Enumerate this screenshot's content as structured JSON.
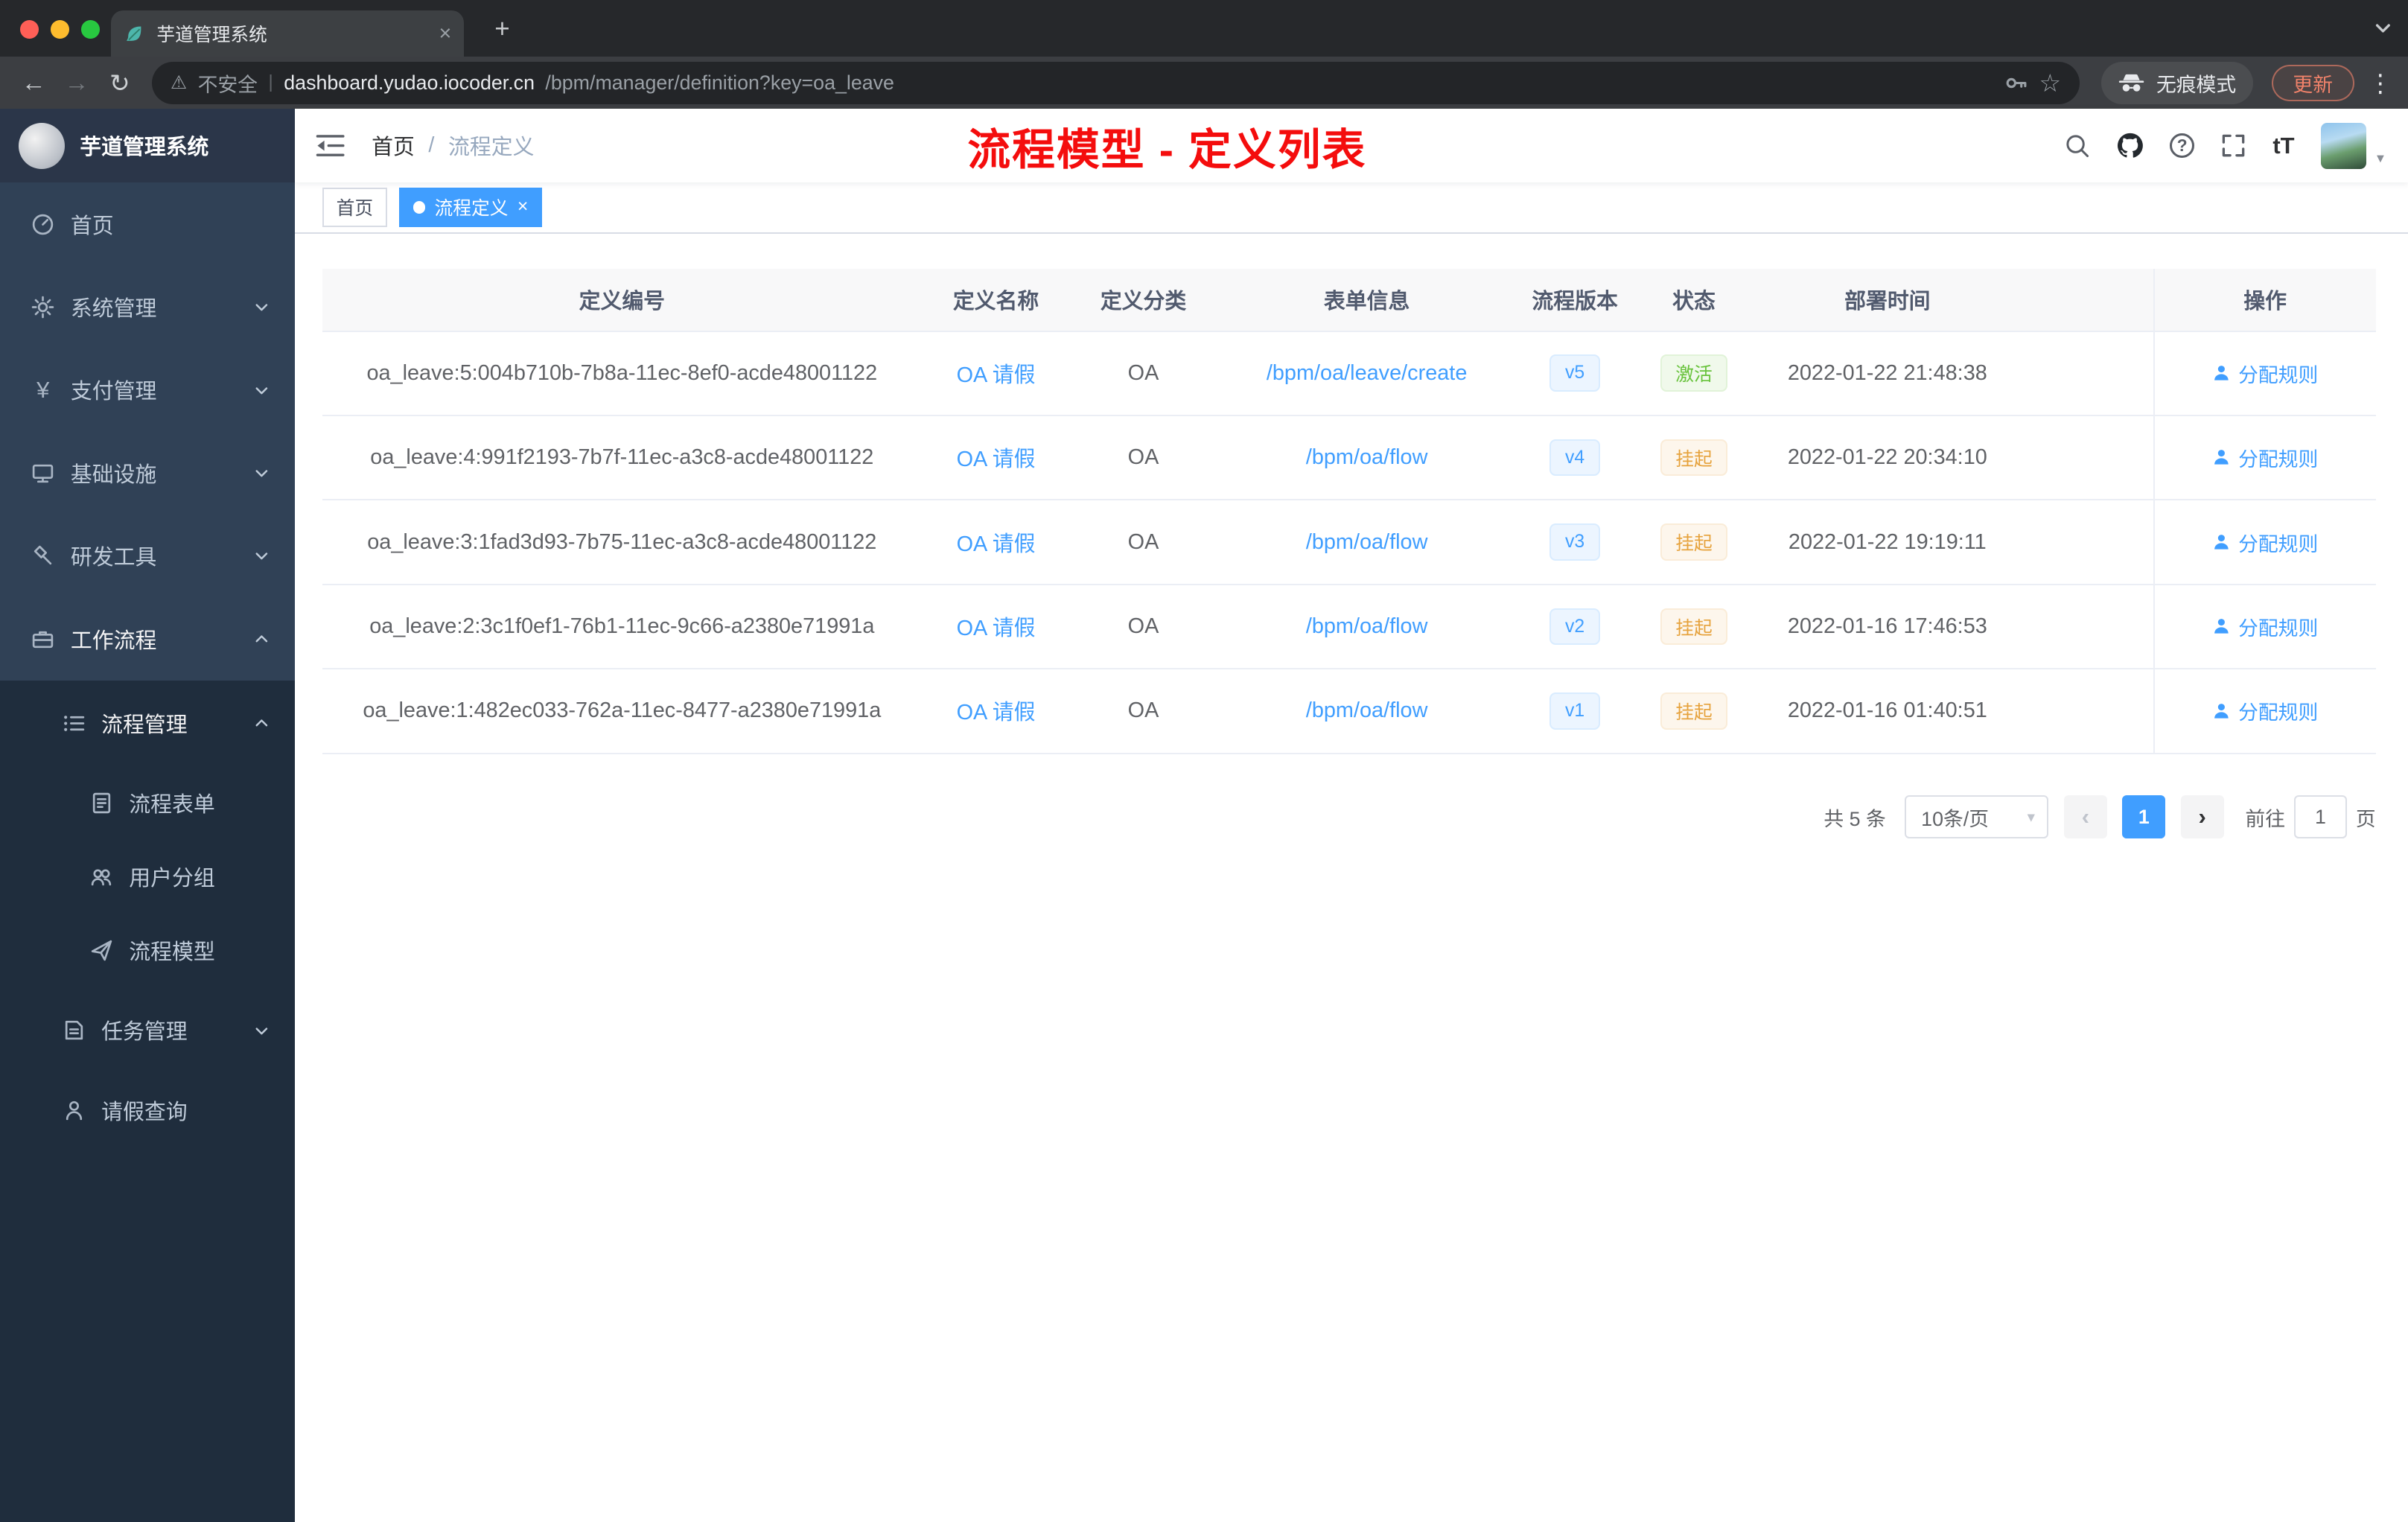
{
  "browser": {
    "tab_title": "芋道管理系统",
    "security_label": "不安全",
    "url_host": "dashboard.yudao.iocoder.cn",
    "url_path": "/bpm/manager/definition?key=oa_leave",
    "incognito_label": "无痕模式",
    "update_label": "更新"
  },
  "icons": {
    "back": "←",
    "forward": "→",
    "reload": "↻",
    "warning": "⚠",
    "star": "☆",
    "menu_dots": "⋮",
    "new_tab": "+",
    "close": "×",
    "url_divider": "|",
    "help": "?",
    "font_size": "tT",
    "caret_down": "▾",
    "avatar_caret": "▼",
    "page_prev": "‹",
    "page_next": "›",
    "yen": "¥"
  },
  "sidebar": {
    "logo_title": "芋道管理系统",
    "items": [
      {
        "label": "首页"
      },
      {
        "label": "系统管理"
      },
      {
        "label": "支付管理"
      },
      {
        "label": "基础设施"
      },
      {
        "label": "研发工具"
      },
      {
        "label": "工作流程"
      },
      {
        "label": "流程管理"
      },
      {
        "label": "流程表单"
      },
      {
        "label": "用户分组"
      },
      {
        "label": "流程模型"
      },
      {
        "label": "任务管理"
      },
      {
        "label": "请假查询"
      }
    ]
  },
  "navbar": {
    "breadcrumb": {
      "home": "首页",
      "separator": "/",
      "current": "流程定义"
    },
    "annotation": "流程模型 - 定义列表"
  },
  "tags": {
    "home": "首页",
    "active": "流程定义"
  },
  "table": {
    "headers": [
      "定义编号",
      "定义名称",
      "定义分类",
      "表单信息",
      "流程版本",
      "状态",
      "部署时间",
      "操作"
    ],
    "rows": [
      {
        "id": "oa_leave:5:004b710b-7b8a-11ec-8ef0-acde48001122",
        "name": "OA 请假",
        "category": "OA",
        "form": "/bpm/oa/leave/create",
        "version": "v5",
        "status": "激活",
        "status_type": "success",
        "time": "2022-01-22 21:48:38",
        "action": "分配规则"
      },
      {
        "id": "oa_leave:4:991f2193-7b7f-11ec-a3c8-acde48001122",
        "name": "OA 请假",
        "category": "OA",
        "form": "/bpm/oa/flow",
        "version": "v4",
        "status": "挂起",
        "status_type": "warning",
        "time": "2022-01-22 20:34:10",
        "action": "分配规则"
      },
      {
        "id": "oa_leave:3:1fad3d93-7b75-11ec-a3c8-acde48001122",
        "name": "OA 请假",
        "category": "OA",
        "form": "/bpm/oa/flow",
        "version": "v3",
        "status": "挂起",
        "status_type": "warning",
        "time": "2022-01-22 19:19:11",
        "action": "分配规则"
      },
      {
        "id": "oa_leave:2:3c1f0ef1-76b1-11ec-9c66-a2380e71991a",
        "name": "OA 请假",
        "category": "OA",
        "form": "/bpm/oa/flow",
        "version": "v2",
        "status": "挂起",
        "status_type": "warning",
        "time": "2022-01-16 17:46:53",
        "action": "分配规则"
      },
      {
        "id": "oa_leave:1:482ec033-762a-11ec-8477-a2380e71991a",
        "name": "OA 请假",
        "category": "OA",
        "form": "/bpm/oa/flow",
        "version": "v1",
        "status": "挂起",
        "status_type": "warning",
        "time": "2022-01-16 01:40:51",
        "action": "分配规则"
      }
    ]
  },
  "pagination": {
    "total": "共 5 条",
    "page_size": "10条/页",
    "current_page": "1",
    "goto_label": "前往",
    "page_unit": "页",
    "goto_value": "1"
  }
}
